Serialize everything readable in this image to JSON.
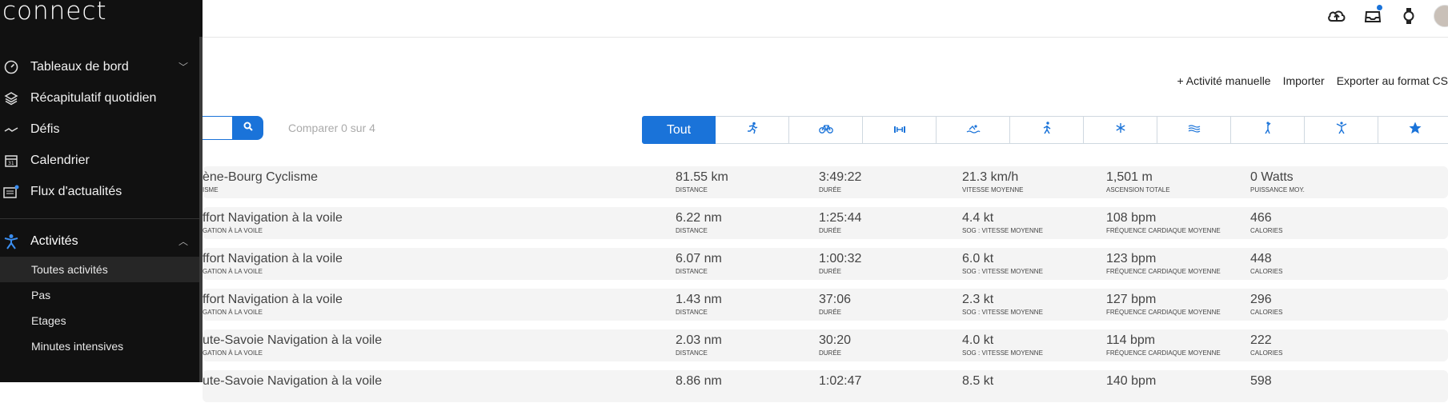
{
  "app": {
    "logo": "connect"
  },
  "sidebar": {
    "items": [
      {
        "label": "Tableaux de bord",
        "icon": "gauge-icon",
        "chevron": "﹀"
      },
      {
        "label": "Récapitulatif quotidien",
        "icon": "layers-icon"
      },
      {
        "label": "Défis",
        "icon": "pulse-icon"
      },
      {
        "label": "Calendrier",
        "icon": "calendar-icon"
      },
      {
        "label": "Flux d'actualités",
        "icon": "newsfeed-icon"
      }
    ],
    "activities": {
      "label": "Activités",
      "icon": "person-icon",
      "chevron": "︿"
    },
    "sub_items": [
      {
        "label": "Toutes activités",
        "selected": true
      },
      {
        "label": "Pas"
      },
      {
        "label": "Etages"
      },
      {
        "label": "Minutes intensives"
      }
    ]
  },
  "topbar": {
    "icons": [
      "upload-icon",
      "inbox-icon",
      "watch-icon",
      "avatar"
    ]
  },
  "actions": {
    "manual": "+ Activité manuelle",
    "import": "Importer",
    "export": "Exporter au format CS"
  },
  "search": {
    "placeholder": ""
  },
  "compare": "Comparer 0 sur 4",
  "filter_tabs": [
    {
      "label": "Tout",
      "icon": ""
    },
    {
      "label": "",
      "icon": "running-icon"
    },
    {
      "label": "",
      "icon": "cycling-icon"
    },
    {
      "label": "",
      "icon": "strength-icon"
    },
    {
      "label": "",
      "icon": "swimming-icon"
    },
    {
      "label": "",
      "icon": "walking-icon"
    },
    {
      "label": "",
      "icon": "snowflake-icon"
    },
    {
      "label": "",
      "icon": "water-icon"
    },
    {
      "label": "",
      "icon": "yoga-icon"
    },
    {
      "label": "",
      "icon": "other-activity-icon"
    },
    {
      "label": "",
      "icon": "star-icon"
    }
  ],
  "activities": [
    {
      "name": "ène-Bourg Cyclisme",
      "type": "ISME",
      "stats": [
        {
          "v": "81.55 km",
          "l": "DISTANCE"
        },
        {
          "v": "3:49:22",
          "l": "DURÉE"
        },
        {
          "v": "21.3 km/h",
          "l": "VITESSE MOYENNE"
        },
        {
          "v": "1,501 m",
          "l": "ASCENSION TOTALE"
        },
        {
          "v": "0 Watts",
          "l": "PUISSANCE MOY."
        }
      ]
    },
    {
      "name": "ffort Navigation à la voile",
      "type": "GATION À LA VOILE",
      "stats": [
        {
          "v": "6.22 nm",
          "l": "DISTANCE"
        },
        {
          "v": "1:25:44",
          "l": "DURÉE"
        },
        {
          "v": "4.4 kt",
          "l": "SOG : VITESSE MOYENNE"
        },
        {
          "v": "108 bpm",
          "l": "FRÉQUENCE CARDIAQUE MOYENNE"
        },
        {
          "v": "466",
          "l": "CALORIES"
        }
      ]
    },
    {
      "name": "ffort Navigation à la voile",
      "type": "GATION À LA VOILE",
      "stats": [
        {
          "v": "6.07 nm",
          "l": "DISTANCE"
        },
        {
          "v": "1:00:32",
          "l": "DURÉE"
        },
        {
          "v": "6.0 kt",
          "l": "SOG : VITESSE MOYENNE"
        },
        {
          "v": "123 bpm",
          "l": "FRÉQUENCE CARDIAQUE MOYENNE"
        },
        {
          "v": "448",
          "l": "CALORIES"
        }
      ]
    },
    {
      "name": "ffort Navigation à la voile",
      "type": "GATION À LA VOILE",
      "stats": [
        {
          "v": "1.43 nm",
          "l": "DISTANCE"
        },
        {
          "v": "37:06",
          "l": "DURÉE"
        },
        {
          "v": "2.3 kt",
          "l": "SOG : VITESSE MOYENNE"
        },
        {
          "v": "127 bpm",
          "l": "FRÉQUENCE CARDIAQUE MOYENNE"
        },
        {
          "v": "296",
          "l": "CALORIES"
        }
      ]
    },
    {
      "name": "ute-Savoie Navigation à la voile",
      "type": "GATION À LA VOILE",
      "stats": [
        {
          "v": "2.03 nm",
          "l": "DISTANCE"
        },
        {
          "v": "30:20",
          "l": "DURÉE"
        },
        {
          "v": "4.0 kt",
          "l": "SOG : VITESSE MOYENNE"
        },
        {
          "v": "114 bpm",
          "l": "FRÉQUENCE CARDIAQUE MOYENNE"
        },
        {
          "v": "222",
          "l": "CALORIES"
        }
      ]
    },
    {
      "name": "ute-Savoie Navigation à la voile",
      "type": "",
      "stats": [
        {
          "v": "8.86 nm",
          "l": ""
        },
        {
          "v": "1:02:47",
          "l": ""
        },
        {
          "v": "8.5 kt",
          "l": ""
        },
        {
          "v": "140 bpm",
          "l": ""
        },
        {
          "v": "598",
          "l": ""
        }
      ]
    }
  ],
  "colors": {
    "accent": "#1a73d9",
    "sidebar_bg": "#111111",
    "row_bg": "#f4f4f4"
  }
}
